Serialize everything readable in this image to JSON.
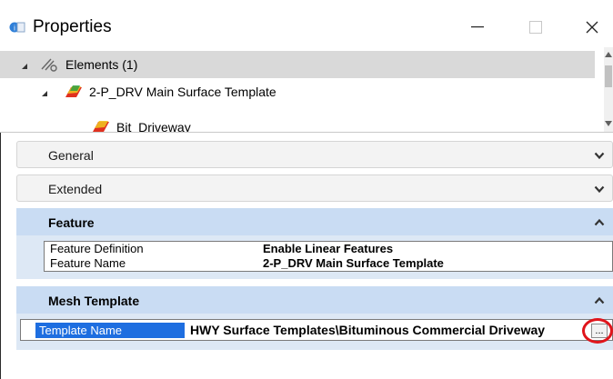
{
  "window": {
    "title": "Properties",
    "icon": "properties-app-icon",
    "controls": {
      "minimize": "—",
      "maximize": "☐",
      "close": "✕"
    }
  },
  "tree": {
    "items": [
      {
        "label": "Elements (1)",
        "icon": "elements-link-icon",
        "expanded": true,
        "selected": true
      },
      {
        "label": "2-P_DRV Main Surface Template",
        "icon": "surface-template-icon",
        "expanded": true
      },
      {
        "label": "Bit_Driveway",
        "icon": "surface-template-icon"
      }
    ]
  },
  "groups": [
    {
      "title": "General",
      "expanded": false,
      "chevron": "chevron-down"
    },
    {
      "title": "Extended",
      "expanded": false,
      "chevron": "chevron-down"
    },
    {
      "title": "Feature",
      "expanded": true,
      "chevron": "chevron-up",
      "properties": [
        {
          "name": "Feature Definition",
          "value": "Enable Linear Features"
        },
        {
          "name": "Feature Name",
          "value": "2-P_DRV Main Surface Template"
        }
      ]
    },
    {
      "title": "Mesh Template",
      "expanded": true,
      "chevron": "chevron-up",
      "properties": [
        {
          "name": "Template Name",
          "value": "HWY Surface Templates\\Bituminous Commercial Driveway",
          "browse_label": "..."
        }
      ]
    }
  ],
  "colors": {
    "expanded_header": "#c9dcf3",
    "selection_blue": "#1e6ee0",
    "highlight_ring": "#e0151b"
  }
}
